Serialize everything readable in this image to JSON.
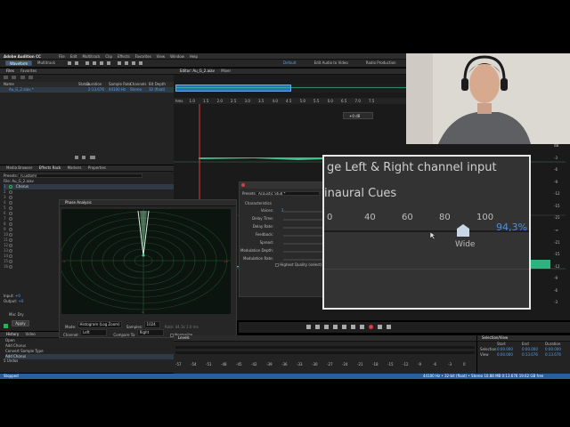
{
  "menubar": {
    "app_name": "Adobe Audition CC",
    "items": [
      "File",
      "Edit",
      "Multitrack",
      "Clip",
      "Effects",
      "Favorites",
      "View",
      "Window",
      "Help"
    ]
  },
  "toolbar": {
    "waveform_label": "Waveform",
    "multitrack_label": "Multitrack",
    "workspaces": [
      "Default",
      "Edit Audio to Video",
      "Radio Production",
      "Waveform"
    ]
  },
  "files_panel": {
    "tabs": [
      "Files",
      "Favorites"
    ],
    "columns": [
      "Name",
      "Status",
      "Duration",
      "Sample Rate",
      "Channels",
      "Bit Depth"
    ],
    "rows": [
      {
        "name": "Au_G_2.aiav *",
        "duration": "2:13.676",
        "sample_rate": "44100 Hz",
        "channels": "Stereo",
        "bit_depth": "32 (float)"
      }
    ]
  },
  "effects_rack": {
    "tabs": [
      "Media Browser",
      "Effects Rack",
      "Markers",
      "Properties"
    ],
    "presets_label": "Presets:",
    "presets_value": "(Custom)",
    "file_label": "File: Au_G_2.aiav",
    "slots": [
      "Chorus",
      "",
      "",
      "",
      "",
      "",
      "",
      "",
      "",
      "",
      "",
      "",
      "",
      "",
      "",
      ""
    ],
    "input_label": "Input:",
    "input_value": "+0",
    "output_label": "Output:",
    "output_value": "+0",
    "mix_label": "Mix:",
    "mix_value": "Dry",
    "apply_label": "Apply"
  },
  "history_panel": {
    "tabs": [
      "History",
      "Video"
    ],
    "items": [
      "Open",
      "Add Chorus",
      "Convert Sample Type",
      "Add Chorus"
    ],
    "footer": "5 Undos",
    "status": "Stopped"
  },
  "editor": {
    "tab_label": "Editor: Au_G_2.aiav",
    "mixer_label": "Mixer",
    "ruler_ticks": [
      "hms",
      "1.0",
      "1.5",
      "2.0",
      "2.5",
      "3.0",
      "3.5",
      "4.0",
      "4.5",
      "5.0",
      "5.5",
      "6.0",
      "6.5",
      "7.0",
      "7.5"
    ],
    "zoom_readout": "+0 dB",
    "db_scale": [
      "dB",
      "-3",
      "-6",
      "-9",
      "-12",
      "-15",
      "-21",
      "-∞",
      "-21",
      "-15",
      "-12",
      "-9",
      "-6",
      "-3"
    ]
  },
  "phase_analysis": {
    "title": "Phase Analysis",
    "mode_label": "Mode:",
    "mode_value": "Histogram (Log Zoom)",
    "samples_label": "Samples:",
    "samples_value": "1024",
    "channel_label": "Channel:",
    "channel_value": "Left",
    "compare_label": "Compare To:",
    "compare_value": "Right",
    "normalize_label": "Normalize",
    "rate_readout": "Rate: 44.1k   1.0 ms"
  },
  "chorus_effect": {
    "presets_label": "Presets:",
    "presets_value": "Acoustic Stud *",
    "section_label": "Characteristics",
    "params": [
      {
        "label": "Voices:",
        "value": "2"
      },
      {
        "label": "Delay Time:",
        "value": ""
      },
      {
        "label": "Delay Rate:",
        "value": ""
      },
      {
        "label": "Feedback:",
        "value": ""
      },
      {
        "label": "Spread:",
        "value": ""
      },
      {
        "label": "Modulation Depth:",
        "value": ""
      },
      {
        "label": "Modulation Rate:",
        "value": ""
      }
    ],
    "highest_quality_label": "Highest Quality (select)"
  },
  "zoom_callout": {
    "line1": "ge Left & Right channel input",
    "line2": "inaural Cues",
    "scale": [
      "0",
      "40",
      "60",
      "80",
      "100"
    ],
    "value": "94,3",
    "value_suffix": "%",
    "knob_label": "Wide"
  },
  "transport": {
    "buttons": [
      "stop",
      "play",
      "pause",
      "to-start",
      "rewind",
      "fast-forward",
      "to-end",
      "record",
      "loop",
      "skip"
    ]
  },
  "levels_panel": {
    "label": "Levels",
    "scale": [
      "-57",
      "-54",
      "-51",
      "-48",
      "-45",
      "-42",
      "-39",
      "-36",
      "-33",
      "-30",
      "-27",
      "-24",
      "-21",
      "-18",
      "-15",
      "-12",
      "-9",
      "-6",
      "-3",
      "0"
    ]
  },
  "selection_view": {
    "title": "Selection/View",
    "columns": [
      "Start",
      "End",
      "Duration"
    ],
    "rows": [
      {
        "label": "Selection",
        "start": "0:00.000",
        "end": "0:00.000",
        "duration": "0:00.000"
      },
      {
        "label": "View",
        "start": "0:00.000",
        "end": "0:13.676",
        "duration": "0:13.676"
      }
    ]
  },
  "status_bar": {
    "text": "44100 Hz • 32-bit (float) • Stereo   10.88 MB   0:13.676   19.62 GB free"
  },
  "colors": {
    "waveform": "#37d69a",
    "playhead": "#e23a3a",
    "selection_blue": "#2d6fb5",
    "panel": "#232323"
  }
}
